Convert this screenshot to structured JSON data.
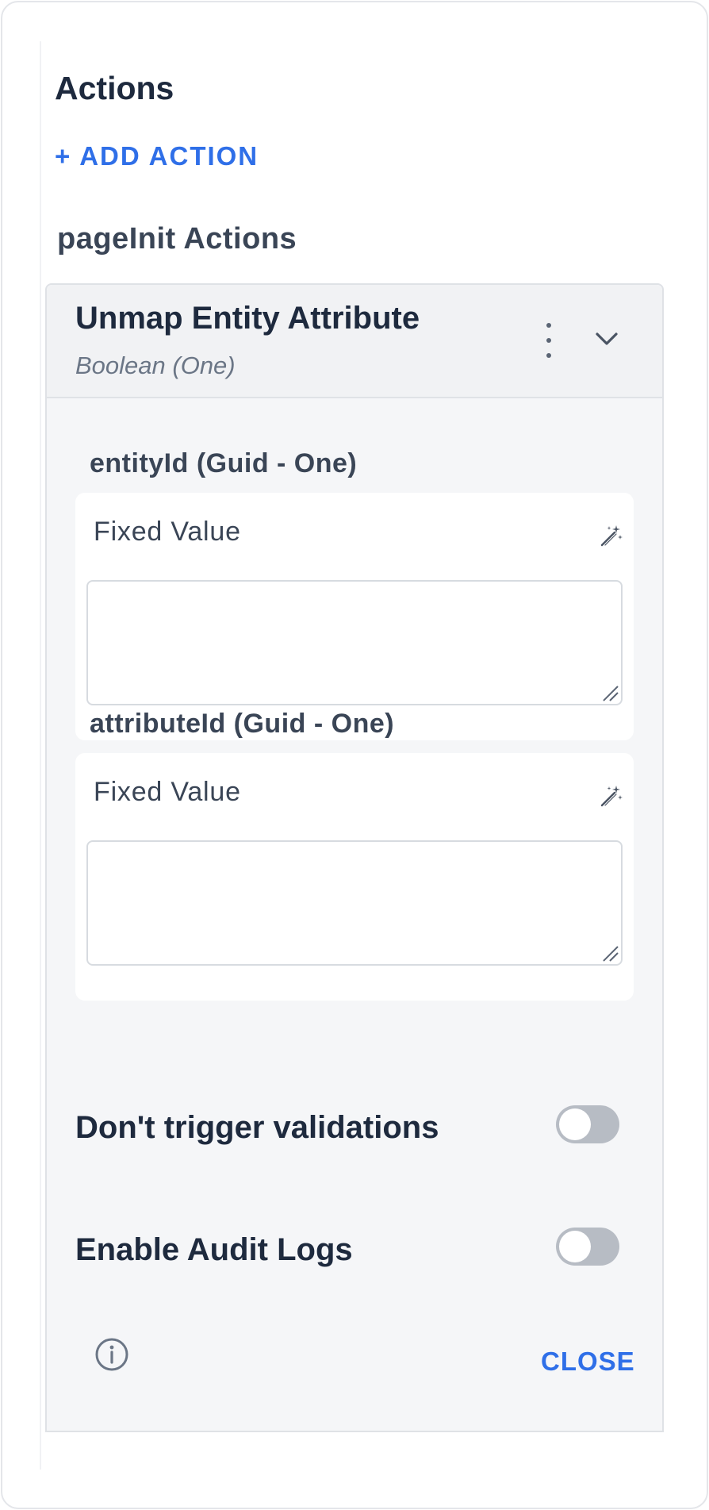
{
  "panel": {
    "title": "Actions",
    "add_action_label": "+ ADD ACTION",
    "group_title": "pageInit Actions"
  },
  "action_card": {
    "title": "Unmap Entity Attribute",
    "subtitle": "Boolean (One)",
    "params": [
      {
        "label": "entityId (Guid - One)",
        "value_type": "Fixed Value",
        "value": ""
      },
      {
        "label": "attributeId (Guid - One)",
        "value_type": "Fixed Value",
        "value": ""
      }
    ],
    "toggles": [
      {
        "label": "Don't trigger validations",
        "on": false
      },
      {
        "label": "Enable Audit Logs",
        "on": false
      }
    ],
    "close_label": "CLOSE"
  },
  "icons": {
    "menu": "more-vertical-icon",
    "expand": "chevron-down-icon",
    "value_picker": "magic-wand-icon",
    "info": "info-circle-icon"
  },
  "colors": {
    "accent": "#2f6fe8",
    "text_primary": "#1e2a3e",
    "toggle_off": "#b7bcc4"
  }
}
